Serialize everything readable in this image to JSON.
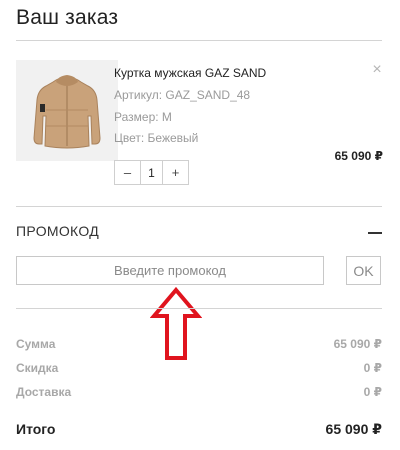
{
  "order": {
    "title": "Ваш заказ"
  },
  "product": {
    "name": "Куртка мужская GAZ SAND",
    "article": "Артикул: GAZ_SAND_48",
    "size": "Размер: M",
    "color": "Цвет: Бежевый",
    "price": "65 090 ₽",
    "remove_label": "×",
    "image_icon": "jacket-image",
    "image_color": "#c9a27a"
  },
  "quantity": {
    "minus": "–",
    "value": "1",
    "plus": "+"
  },
  "promo": {
    "title": "ПРОМОКОД",
    "placeholder": "Введите промокод",
    "value": "",
    "ok_label": "OK"
  },
  "summary": {
    "rows": [
      {
        "label": "Сумма",
        "value": "65 090 ₽"
      },
      {
        "label": "Скидка",
        "value": "0 ₽"
      },
      {
        "label": "Доставка",
        "value": "0 ₽"
      }
    ],
    "total_label": "Итого",
    "total_value": "65 090 ₽"
  },
  "annotation": {
    "icon": "red-up-arrow-icon",
    "color": "#e0141e"
  }
}
